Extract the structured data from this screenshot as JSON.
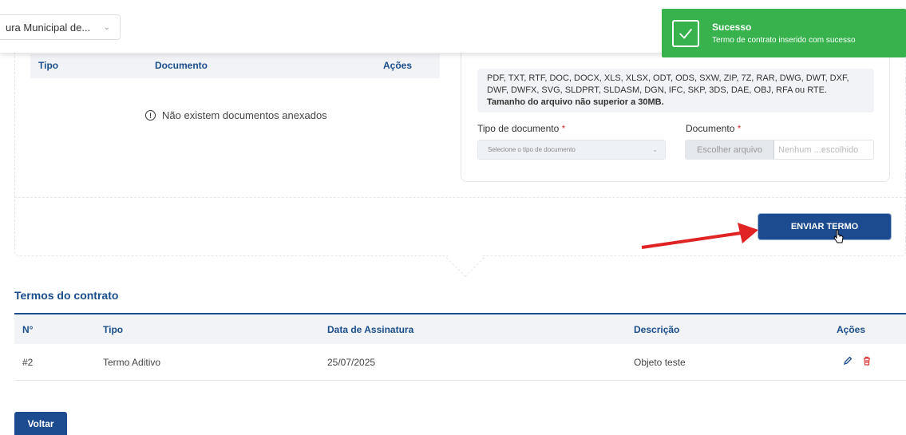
{
  "header": {
    "org_select_value": "ura Municipal de..."
  },
  "toast": {
    "title": "Sucesso",
    "message": "Termo de contrato inserido com sucesso",
    "color": "#37b24d"
  },
  "documents": {
    "columns": [
      "Tipo",
      "Documento",
      "Ações"
    ],
    "empty_message": "Não existem documentos anexados"
  },
  "upload": {
    "formats_text": "PDF, TXT, RTF, DOC, DOCX, XLS, XLSX, ODT, ODS, SXW, ZIP, 7Z, RAR, DWG, DWT, DXF, DWF, DWFX, SVG, SLDPRT, SLDASM, DGN, IFC, SKP, 3DS, DAE, OBJ, RFA ou RTE.",
    "size_limit": "Tamanho do arquivo não superior a 30MB.",
    "doc_type_label": "Tipo de documento",
    "doc_type_placeholder": "Selecione o tipo de documento",
    "document_label": "Documento",
    "required_mark": "*",
    "choose_file_label": "Escolher arquivo",
    "file_name_placeholder": "Nenhum ...escolhido"
  },
  "send_button_label": "ENVIAR TERMO",
  "terms": {
    "title": "Termos do contrato",
    "columns": [
      "N°",
      "Tipo",
      "Data de Assinatura",
      "Descrição",
      "Ações"
    ],
    "rows": [
      {
        "numero": "#2",
        "tipo": "Termo Aditivo",
        "data": "25/07/2025",
        "descricao": "Objeto teste"
      }
    ]
  },
  "back_button_label": "Voltar",
  "colors": {
    "primary": "#1d4b8f",
    "heading": "#1b4e8c",
    "danger": "#d9383a",
    "annotation_arrow": "#e02424"
  },
  "icons": {
    "check": "check-icon",
    "info": "info-circle-icon",
    "edit": "pencil-icon",
    "delete": "trash-icon",
    "chevron": "chevron-down-icon"
  }
}
